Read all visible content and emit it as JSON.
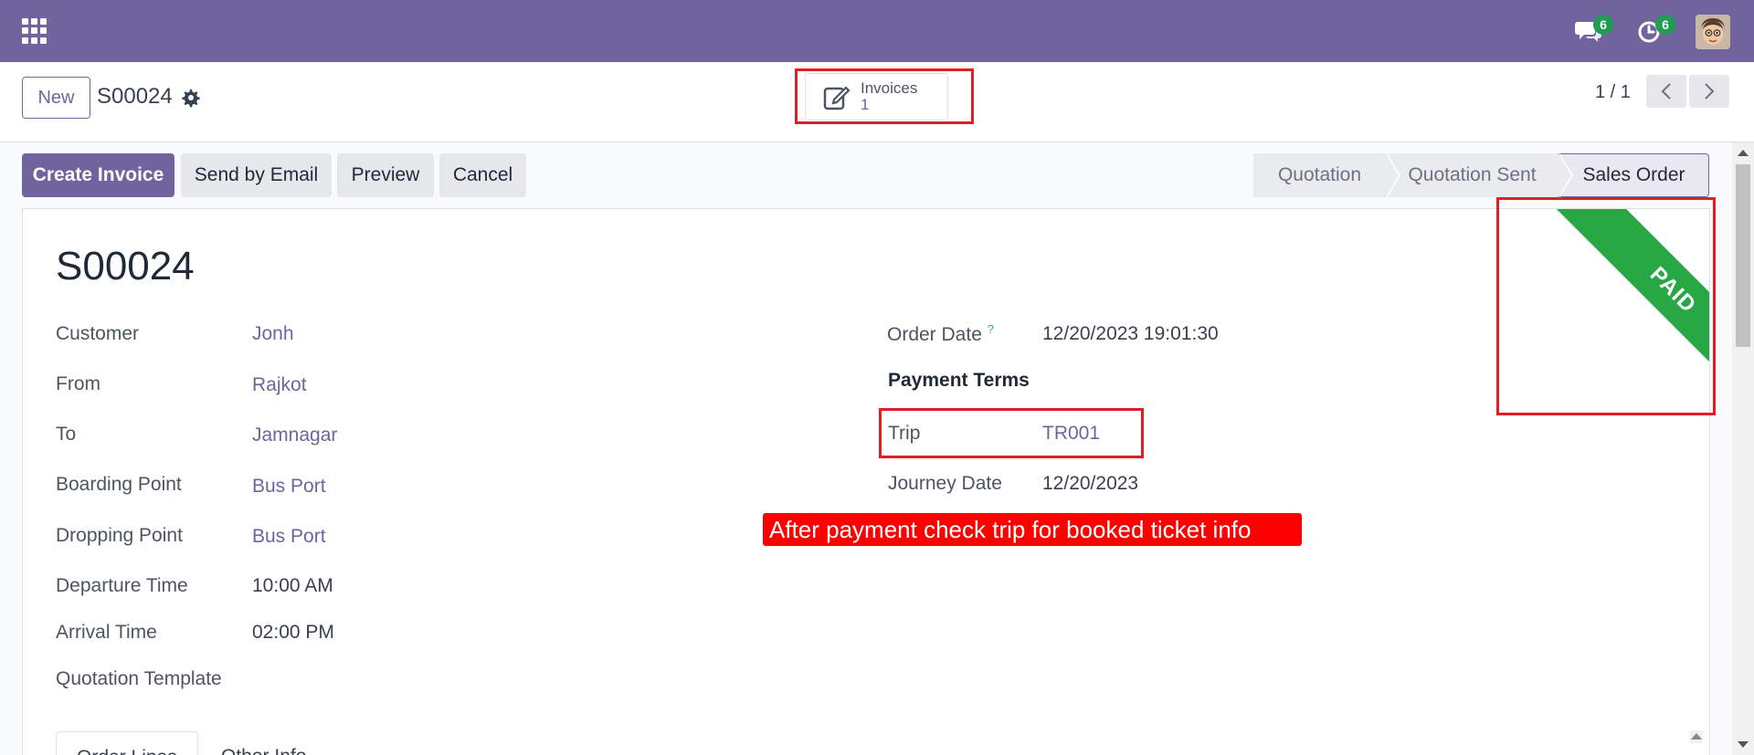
{
  "nav": {
    "apps_icon": "grid-icon",
    "messages_count": "6",
    "activities_count": "6"
  },
  "control": {
    "new_label": "New",
    "record_name": "S00024",
    "smart_button": {
      "label": "Invoices",
      "value": "1"
    },
    "pager": "1 / 1"
  },
  "actions": {
    "create_invoice": "Create Invoice",
    "send_by_email": "Send by Email",
    "preview": "Preview",
    "cancel": "Cancel"
  },
  "stages": [
    "Quotation",
    "Quotation Sent",
    "Sales Order"
  ],
  "sheet": {
    "title": "S00024",
    "ribbon": "PAID",
    "left_fields": [
      {
        "label": "Customer",
        "value": "Jonh"
      },
      {
        "label": "From",
        "value": "Rajkot"
      },
      {
        "label": "To",
        "value": "Jamnagar"
      },
      {
        "label": "Boarding Point",
        "value": "Bus Port"
      },
      {
        "label": "Dropping Point",
        "value": "Bus Port"
      },
      {
        "label": "Departure Time",
        "value": "10:00 AM"
      },
      {
        "label": "Arrival Time",
        "value": "02:00 PM"
      },
      {
        "label": "Quotation Template",
        "value": ""
      }
    ],
    "right_fields": {
      "order_date_label": "Order Date",
      "order_date_help": "?",
      "order_date_value": "12/20/2023 19:01:30",
      "payment_terms_label": "Payment Terms",
      "trip_label": "Trip",
      "trip_value": "TR001",
      "journey_date_label": "Journey Date",
      "journey_date_value": "12/20/2023"
    },
    "annotation": "After payment check trip for booked ticket info",
    "tabs": [
      "Order Lines",
      "Other Info"
    ]
  },
  "colors": {
    "brand": "#71639e",
    "ribbon": "#28a745",
    "highlight": "#e21e25",
    "badge": "#1f9d55"
  }
}
